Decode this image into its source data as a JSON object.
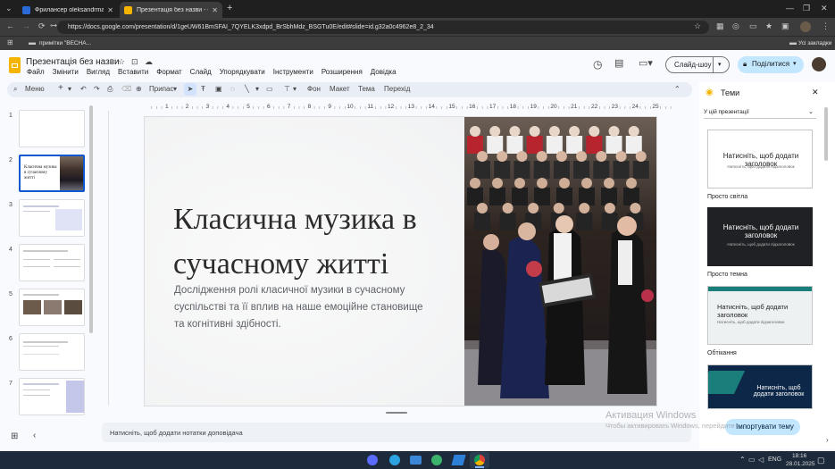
{
  "browser": {
    "tabs": [
      {
        "title": "Фрилансер oleksandrmazula1"
      },
      {
        "title": "Презентація без назви - Goog"
      }
    ],
    "url": "https://docs.google.com/presentation/d/1geUW61BmSFAI_7QYELK3xdpd_BrSbhMdz_BSGTu0E/edit#slide=id.g32a0c4962e8_2_34",
    "bookmark": "примітки \"ВЕСНА...",
    "all_bookmarks": "Усі закладки"
  },
  "doc": {
    "title": "Презентація без назви",
    "menu": [
      "Файл",
      "Змінити",
      "Вигляд",
      "Вставити",
      "Формат",
      "Слайд",
      "Упорядкувати",
      "Інструменти",
      "Розширення",
      "Довідка"
    ],
    "slideshow_label": "Слайд-шоу",
    "share_label": "Поділитися"
  },
  "toolbar": {
    "menu_search": "Меню",
    "fit": "Припас",
    "background": "Фон",
    "layout": "Макет",
    "theme": "Тема",
    "transition": "Перехід"
  },
  "ruler": [
    "1",
    "2",
    "3",
    "4",
    "5",
    "6",
    "7",
    "8",
    "9",
    "10",
    "11",
    "12",
    "13",
    "14",
    "15",
    "16",
    "17",
    "18",
    "19",
    "20",
    "21",
    "22",
    "23",
    "24",
    "25"
  ],
  "slides": [
    {
      "num": "1"
    },
    {
      "num": "2",
      "title": "Класична музика в сучасному житті"
    },
    {
      "num": "3"
    },
    {
      "num": "4"
    },
    {
      "num": "5"
    },
    {
      "num": "6"
    },
    {
      "num": "7"
    }
  ],
  "slide": {
    "title_line1": "Класична музика в",
    "title_line2": "сучасному житті",
    "body": "Дослідження ролі класичної музики в сучасному суспільстві та її вплив на наше емоційне становище та когнітивні здібності."
  },
  "notes_placeholder": "Натисніть, щоб додати нотатки доповідача",
  "themes": {
    "header": "Теми",
    "section": "У цій презентації",
    "card_title": "Натисніть, щоб додати заголовок",
    "card_sub": "Натисніть, щоб додати підзаголовок",
    "items": [
      "Просто світла",
      "Просто темна",
      "Обтікання"
    ],
    "import_label": "Імпортувати тему"
  },
  "watermark": {
    "line1": "Активация Windows",
    "line2": "Чтобы активировать Windows, перейдите"
  },
  "taskbar": {
    "lang": "ENG",
    "time": "18:16",
    "date": "28.01.2025"
  },
  "colors": {
    "accent_blue": "#c2e7ff",
    "logo_yellow": "#f4b400",
    "dark_theme": "#202124",
    "teal": "#1a7f7a"
  }
}
